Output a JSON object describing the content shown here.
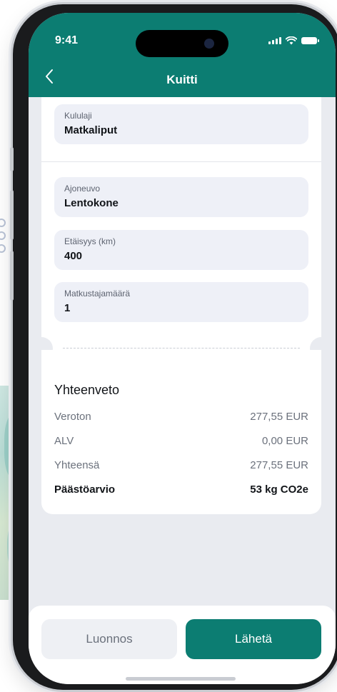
{
  "status_bar": {
    "time": "9:41"
  },
  "header": {
    "title": "Kuitti"
  },
  "fields": [
    {
      "label": "Kululaji",
      "value": "Matkaliput"
    },
    {
      "label": "Ajoneuvo",
      "value": "Lentokone"
    },
    {
      "label": "Etäisyys (km)",
      "value": "400"
    },
    {
      "label": "Matkustajamäärä",
      "value": "1"
    }
  ],
  "summary": {
    "title": "Yhteenveto",
    "rows": [
      {
        "label": "Veroton",
        "value": "277,55 EUR"
      },
      {
        "label": "ALV",
        "value": "0,00 EUR"
      },
      {
        "label": "Yhteensä",
        "value": "277,55 EUR"
      },
      {
        "label": "Päästöarvio",
        "value": "53 kg CO2e"
      }
    ]
  },
  "actions": {
    "draft_label": "Luonnos",
    "send_label": "Lähetä"
  },
  "colors": {
    "brand": "#0c7d72",
    "screen_bg": "#e9ebf0",
    "field_bg": "#eef0f7"
  },
  "icons": {
    "back": "chevron-left-icon",
    "signal": "cellular-signal-icon",
    "wifi": "wifi-icon",
    "battery": "battery-icon"
  }
}
